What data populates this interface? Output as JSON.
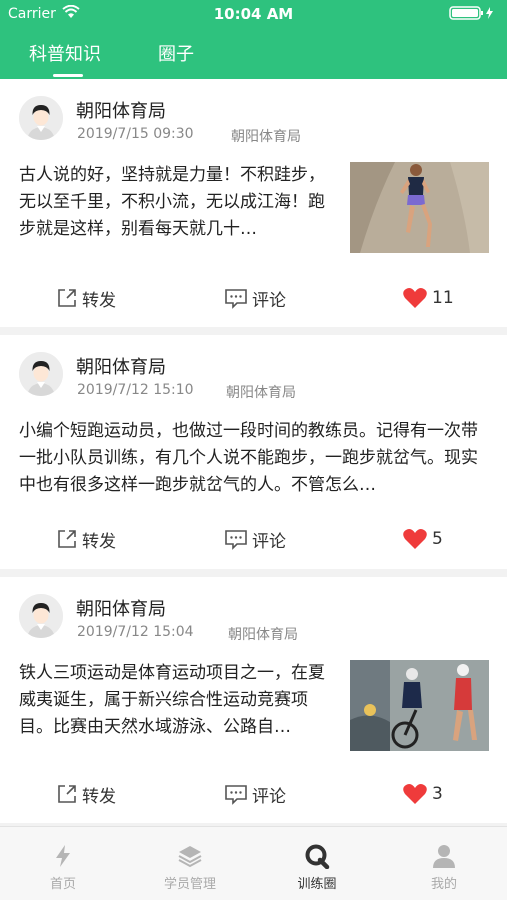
{
  "status": {
    "carrier": "Carrier",
    "time": "10:04 AM"
  },
  "tabs": [
    {
      "label": "科普知识",
      "active": true
    },
    {
      "label": "圈子",
      "active": false
    }
  ],
  "posts": [
    {
      "author": "朝阳体育局",
      "date": "2019/7/15 09:30",
      "source": "朝阳体育局",
      "text": "古人说的好，坚持就是力量！不积跬步，无以至千里，不积小流，无以成江海！跑步就是这样，别看每天就几十…",
      "share": "转发",
      "comment": "评论",
      "likes": "11"
    },
    {
      "author": "朝阳体育局",
      "date": "2019/7/12 15:10",
      "source": "朝阳体育局",
      "text": "小编个短跑运动员，也做过一段时间的教练员。记得有一次带一批小队员训练，有几个人说不能跑步，一跑步就岔气。现实中也有很多这样一跑步就岔气的人。不管怎么…",
      "share": "转发",
      "comment": "评论",
      "likes": "5"
    },
    {
      "author": "朝阳体育局",
      "date": "2019/7/12 15:04",
      "source": "朝阳体育局",
      "text": "铁人三项运动是体育运动项目之一，在夏威夷诞生，属于新兴综合性运动竞赛项目。比赛由天然水域游泳、公路自…",
      "share": "转发",
      "comment": "评论",
      "likes": "3"
    }
  ],
  "tabbar": [
    {
      "label": "首页",
      "icon": "lightning-icon",
      "active": false
    },
    {
      "label": "学员管理",
      "icon": "layers-icon",
      "active": false
    },
    {
      "label": "训练圈",
      "icon": "q-icon",
      "active": true
    },
    {
      "label": "我的",
      "icon": "person-icon",
      "active": false
    }
  ],
  "colors": {
    "brand": "#2ec27e",
    "like": "#ef3b3b",
    "text": "#222222",
    "muted": "#888888"
  }
}
